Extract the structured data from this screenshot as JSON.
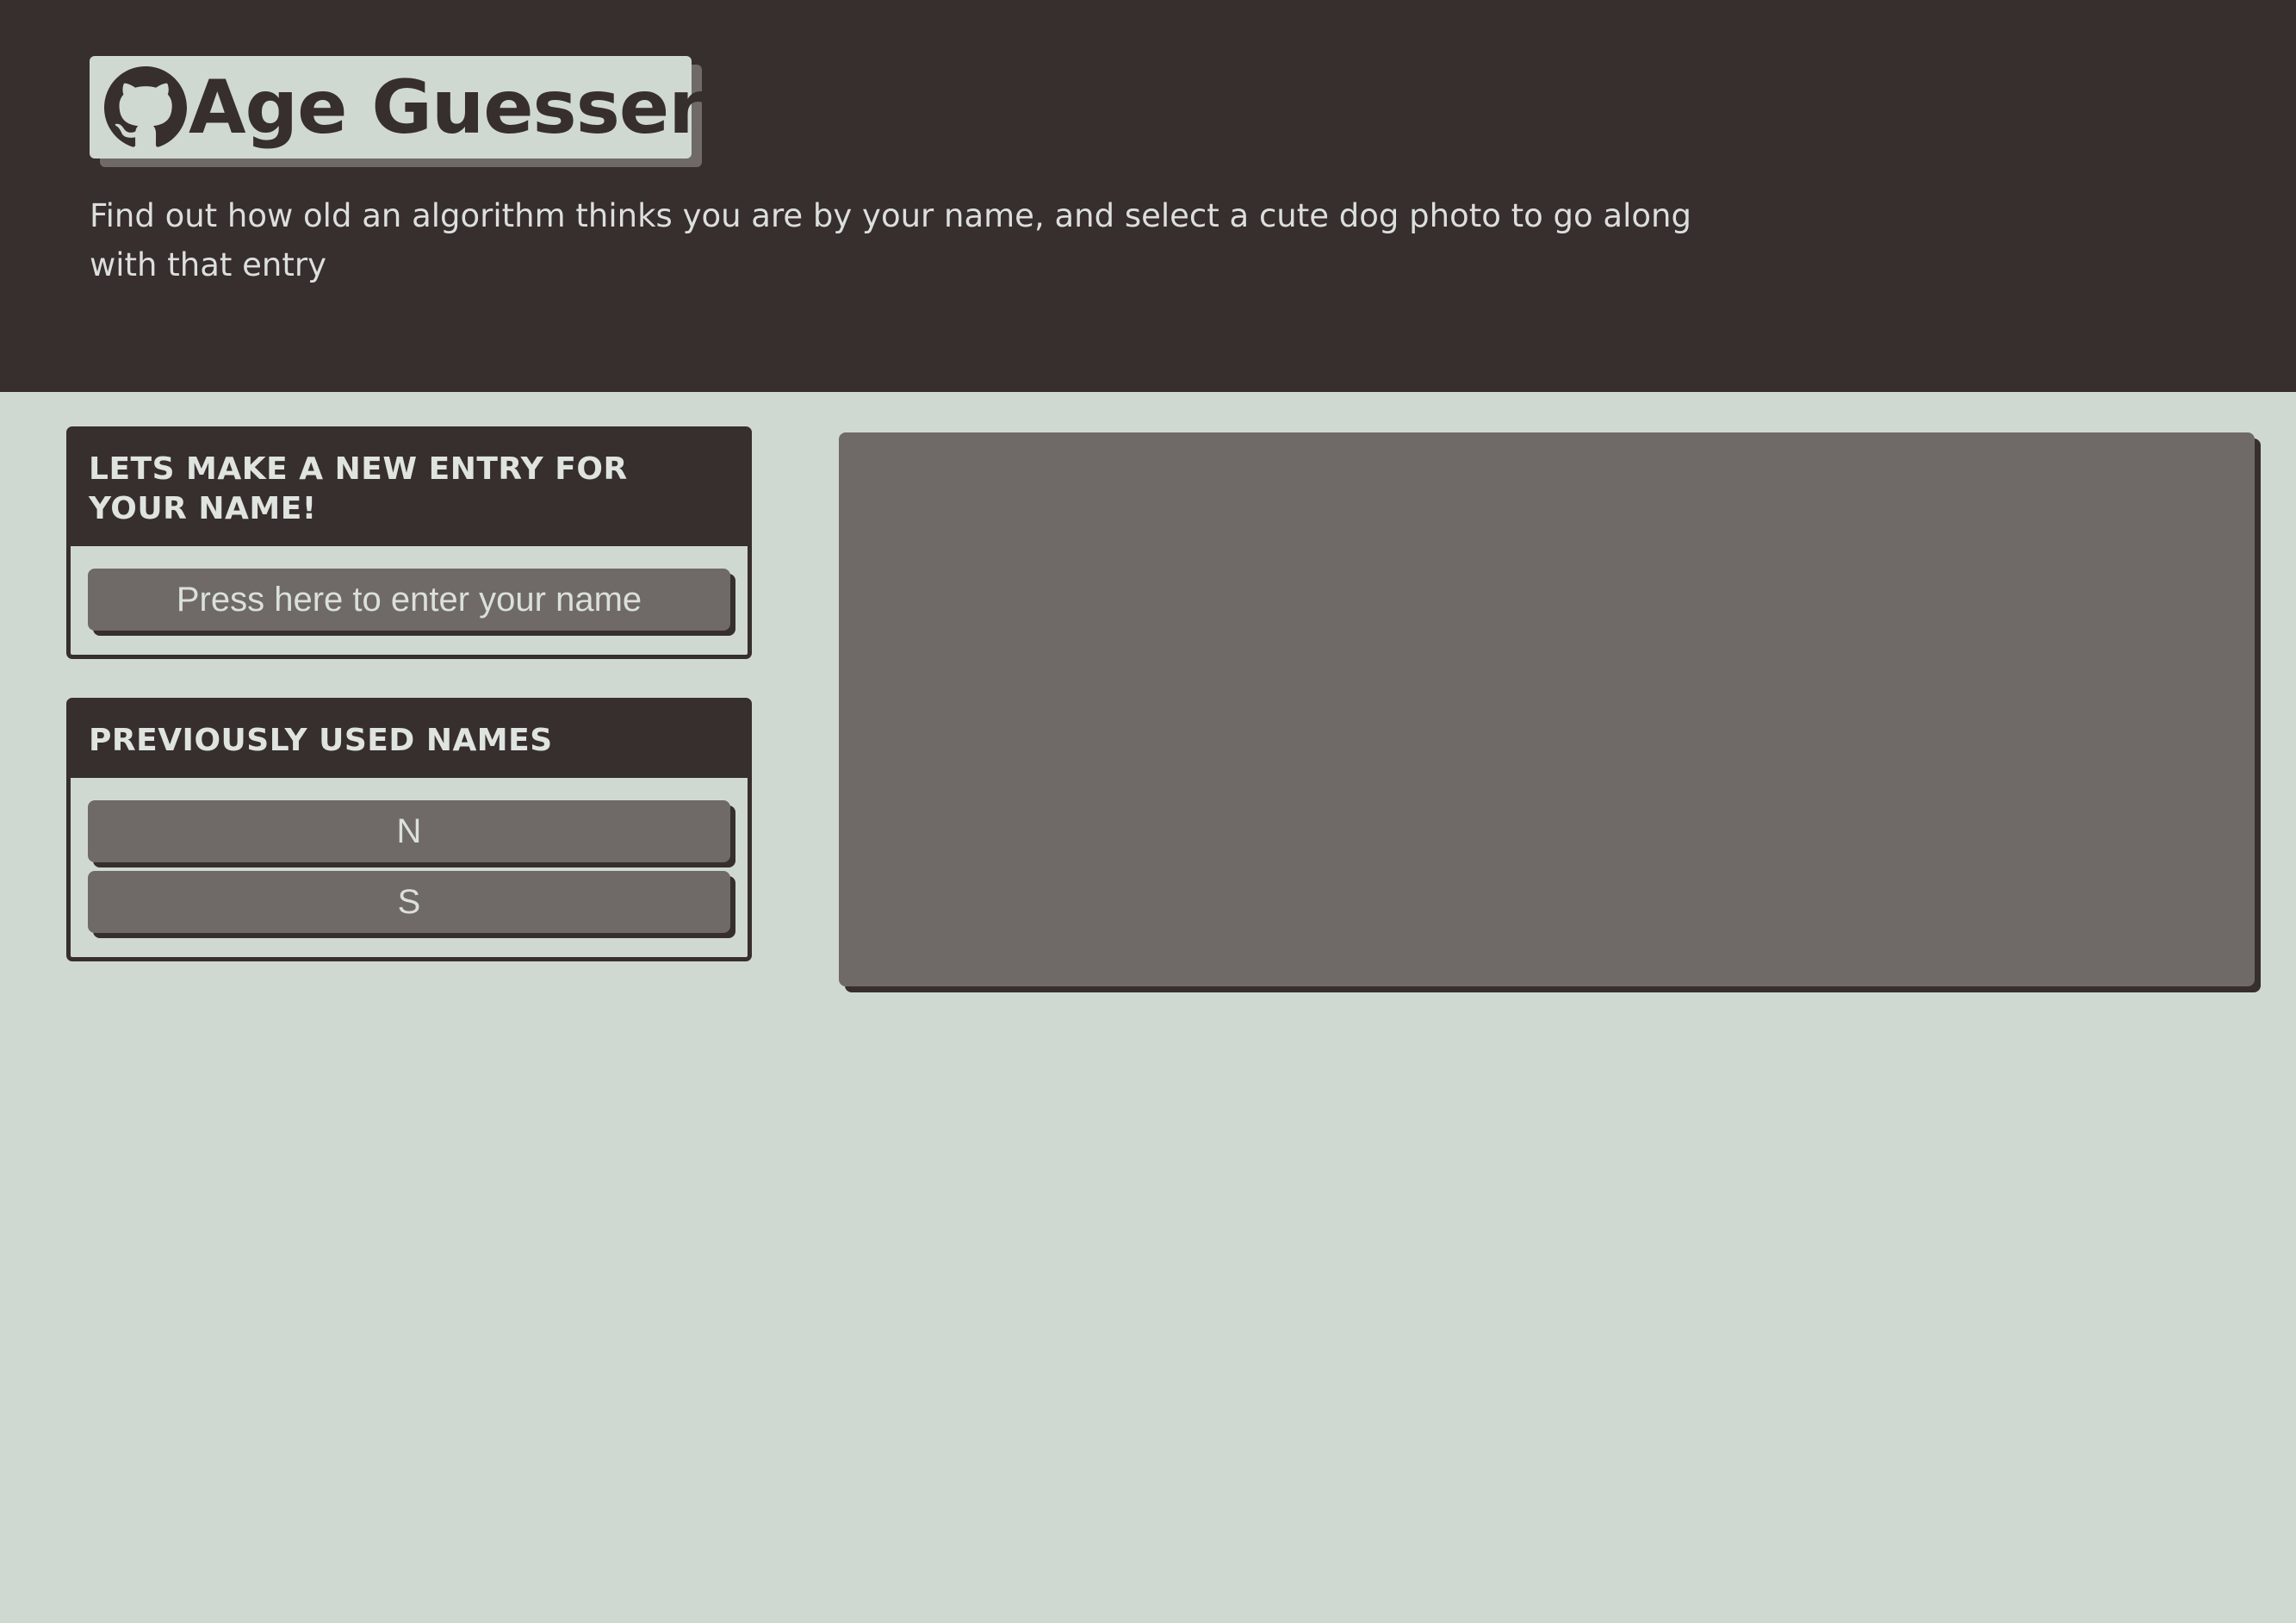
{
  "header": {
    "title": "Age Guesser",
    "github_icon": "github-icon",
    "subtitle": "Find out how old an algorithm thinks you are by your name, and select a cute dog photo to go along with that entry"
  },
  "new_entry": {
    "heading": "LETS MAKE A NEW ENTRY FOR YOUR NAME!",
    "button_label": "Press here to enter your name"
  },
  "previous": {
    "heading": "PREVIOUSLY USED NAMES",
    "names": [
      "N",
      "S"
    ]
  },
  "colors": {
    "dark": "#372e2e",
    "background": "#cfd9d1",
    "button": "#6f6a67",
    "text_light": "#dbe0db"
  }
}
